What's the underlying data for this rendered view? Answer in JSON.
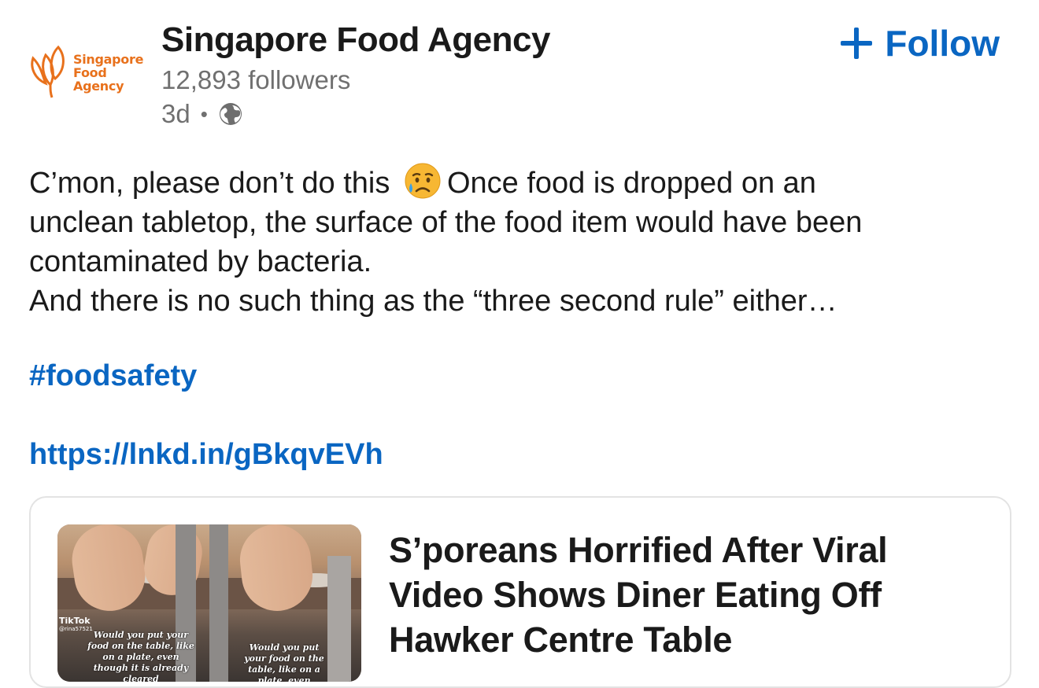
{
  "org": {
    "logo_lines": [
      "Singapore",
      "Food",
      "Agency"
    ],
    "name": "Singapore Food Agency",
    "followers": "12,893 followers",
    "time": "3d",
    "separator": "•",
    "visibility_icon": "globe-icon"
  },
  "follow": {
    "label": "Follow",
    "icon": "plus-icon",
    "color": "#0a66c2"
  },
  "post": {
    "line1_a": "C’mon, please don’t do this",
    "emoji": "sad-sweat-face-emoji",
    "line1_b": "Once food is dropped on an",
    "line2": "unclean tabletop, the surface of the food item would have been",
    "line3": "contaminated by bacteria.",
    "line4": "And there is no such thing as the “three second rule” either…",
    "hashtag": "#foodsafety",
    "link": "https://lnkd.in/gBkqvEVh"
  },
  "card": {
    "title": "S’poreans Horrified After Viral Video Shows Diner Eating Off Hawker Centre Table",
    "thumb": {
      "brand": "TikTok",
      "user": "@rina57521",
      "caption_left": "Would you put your food on the table, like on a plate, even though it is already cleared",
      "caption_right": "Would you put your food on the table, like on a plate, even though"
    }
  },
  "colors": {
    "brand_orange": "#e8711c",
    "link_blue": "#0a66c2",
    "muted": "#707070"
  }
}
